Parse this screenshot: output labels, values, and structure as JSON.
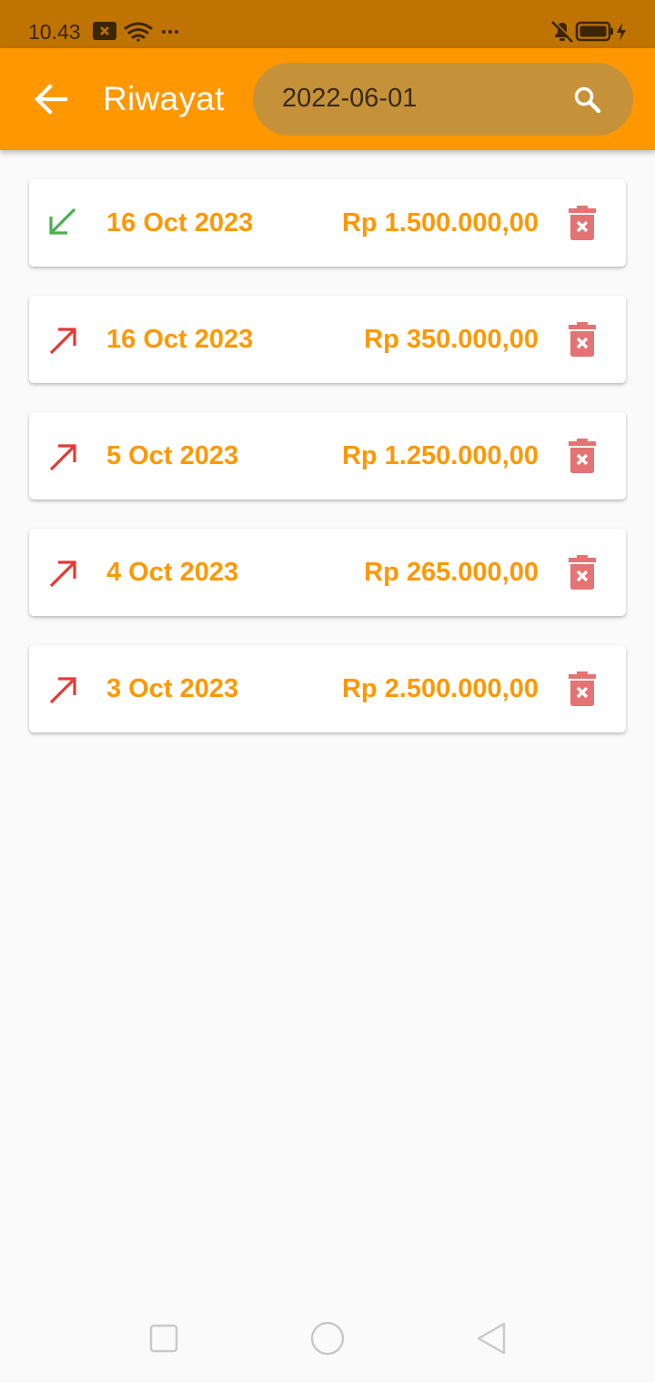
{
  "status_bar": {
    "time": "10.43",
    "icons": [
      "notification-x-icon",
      "wifi-icon",
      "more-dots-icon",
      "bell-off-icon",
      "battery-charging-icon"
    ]
  },
  "app_bar": {
    "title": "Riwayat",
    "back_icon": "arrow-left-icon",
    "search": {
      "value": "2022-06-01",
      "icon": "search-icon"
    }
  },
  "transactions": [
    {
      "direction": "incoming",
      "date": "16 Oct 2023",
      "amount": "Rp 1.500.000,00"
    },
    {
      "direction": "outgoing",
      "date": "16 Oct 2023",
      "amount": "Rp 350.000,00"
    },
    {
      "direction": "outgoing",
      "date": "5 Oct 2023",
      "amount": "Rp 1.250.000,00"
    },
    {
      "direction": "outgoing",
      "date": "4 Oct 2023",
      "amount": "Rp 265.000,00"
    },
    {
      "direction": "outgoing",
      "date": "3 Oct 2023",
      "amount": "Rp 2.500.000,00"
    }
  ],
  "colors": {
    "app_bar": "#ff9800",
    "status_bar": "#bf7300",
    "search_box": "#c5923a",
    "accent_text": "#ff9800",
    "incoming": "#4caf50",
    "outgoing": "#e53935",
    "delete": "#e57373"
  },
  "nav_bar": {
    "buttons": [
      "recents-square-icon",
      "home-circle-icon",
      "back-triangle-icon"
    ]
  }
}
